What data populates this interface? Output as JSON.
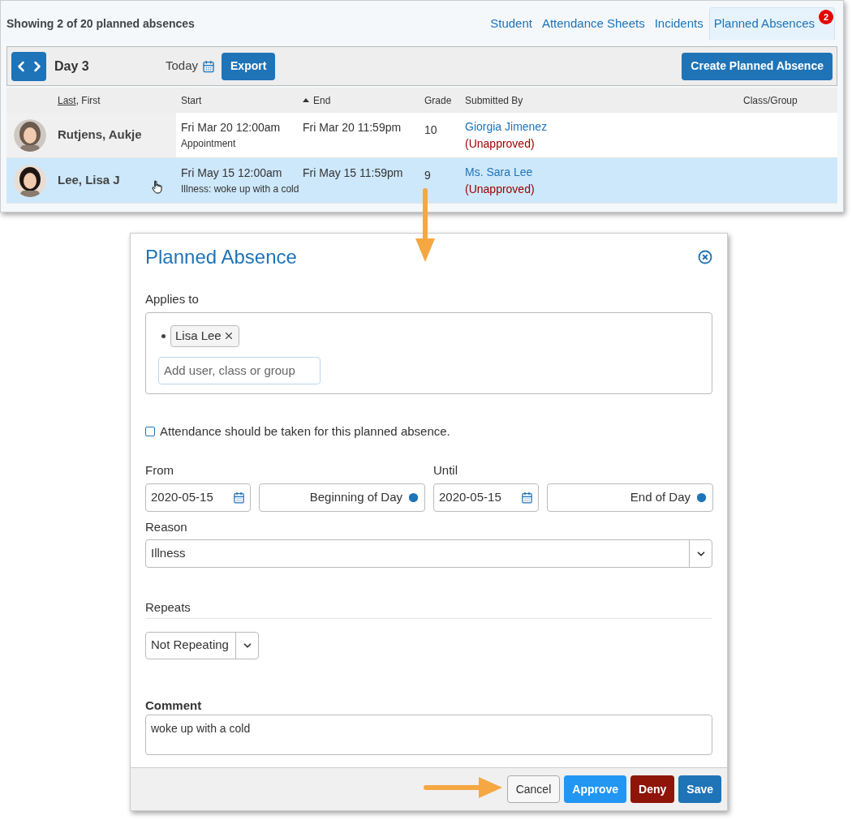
{
  "list_panel": {
    "summary": "Showing 2 of 20 planned absences",
    "tabs": [
      {
        "label": "Student",
        "selected": false
      },
      {
        "label": "Attendance Sheets",
        "selected": false
      },
      {
        "label": "Incidents",
        "selected": false
      },
      {
        "label": "Planned Absences",
        "selected": true,
        "badge": "2"
      }
    ],
    "toolbar": {
      "day": "Day 3",
      "today": "Today",
      "export": "Export",
      "create": "Create Planned Absence"
    },
    "columns": [
      {
        "label": "Last",
        "suffix": ", First",
        "sorted": false
      },
      {
        "label": "Start",
        "sorted": false
      },
      {
        "label": "End",
        "sorted": true
      },
      {
        "label": "Grade",
        "sorted": false
      },
      {
        "label": "Submitted By",
        "sorted": false
      },
      {
        "label": "Class/Group",
        "sorted": false
      }
    ],
    "rows": [
      {
        "name": "Rutjens, Aukje",
        "start": "Fri Mar 20 12:00am",
        "end": "Fri Mar 20 11:59pm",
        "note": "Appointment",
        "grade": "10",
        "submitted_by": "Giorgia Jimenez",
        "status": "(Unapproved)",
        "selected": false
      },
      {
        "name": "Lee, Lisa J",
        "start": "Fri May 15 12:00am",
        "end": "Fri May 15 11:59pm",
        "note": "Illness: woke up with a cold",
        "grade": "9",
        "submitted_by": "Ms. Sara Lee",
        "status": "(Unapproved)",
        "selected": true
      }
    ]
  },
  "dialog": {
    "title": "Planned Absence",
    "applies_to": {
      "label": "Applies to",
      "chips": [
        "Lisa Lee"
      ],
      "placeholder": "Add user, class or group"
    },
    "attendance": {
      "label": "Attendance should be taken for this planned absence.",
      "checked": false
    },
    "from": {
      "label": "From",
      "date": "2020-05-15",
      "time": "Beginning of Day"
    },
    "until": {
      "label": "Until",
      "date": "2020-05-15",
      "time": "End of Day"
    },
    "reason": {
      "label": "Reason",
      "value": "Illness"
    },
    "repeats": {
      "label": "Repeats",
      "value": "Not Repeating"
    },
    "comment": {
      "label": "Comment",
      "value": "woke up with a cold"
    },
    "buttons": [
      {
        "label": "Cancel",
        "kind": "cancel"
      },
      {
        "label": "Approve",
        "kind": "approve"
      },
      {
        "label": "Deny",
        "kind": "deny"
      },
      {
        "label": "Save",
        "kind": "save"
      }
    ]
  }
}
